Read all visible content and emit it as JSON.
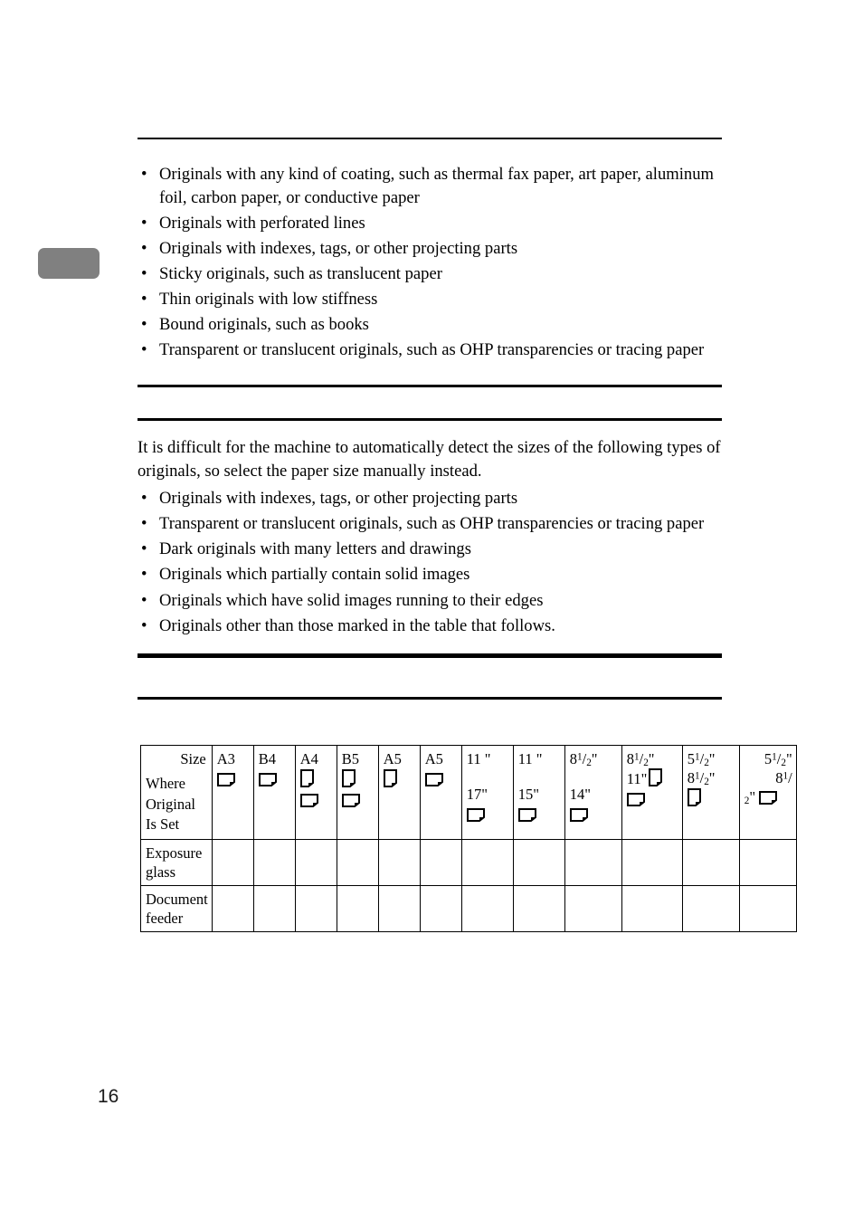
{
  "page": {
    "number": "16"
  },
  "section_one": {
    "bullets": [
      "Originals with any kind of coating, such as thermal fax paper, art paper, aluminum foil, carbon paper, or conductive paper",
      "Originals with perforated lines",
      "Originals with indexes, tags, or other projecting parts",
      "Sticky originals, such as translucent paper",
      "Thin originals with low stiffness",
      "Bound originals, such as books",
      "Transparent or translucent originals, such as OHP transparencies or tracing paper"
    ],
    "bullet_glyph": "•"
  },
  "section_two": {
    "intro": "It is difficult for the machine to automatically detect the sizes of the following types of originals, so select the paper size manually instead.",
    "bullets": [
      "Originals with indexes, tags, or other projecting parts",
      "Transparent or translucent originals, such as OHP transparencies or tracing paper",
      "Dark originals with many letters and drawings",
      "Originals which partially contain solid images",
      "Originals which have solid images running to their edges",
      "Originals other than those marked     in the table that follows."
    ]
  },
  "table": {
    "corner": {
      "size_label": "Size",
      "where_label": "Where Original Is Set"
    },
    "row_labels": [
      "Exposure glass",
      "Document feeder"
    ],
    "columns": [
      {
        "id": "a3",
        "label": "A3",
        "icons": [
          "landscape"
        ]
      },
      {
        "id": "b4",
        "label": "B4",
        "icons": [
          "landscape"
        ]
      },
      {
        "id": "a4",
        "label": "A4",
        "icons": [
          "portrait",
          "landscape"
        ]
      },
      {
        "id": "b5",
        "label": "B5",
        "icons": [
          "portrait",
          "landscape"
        ]
      },
      {
        "id": "a5-portrait",
        "label": "A5",
        "icons": [
          "portrait"
        ]
      },
      {
        "id": "a5-landscape",
        "label": "A5",
        "icons": [
          "landscape"
        ]
      },
      {
        "id": "11x17",
        "line1": "11 \"",
        "line2": "17\"",
        "icons": [
          "landscape"
        ]
      },
      {
        "id": "11x15",
        "line1": "11 \"",
        "line2": "15\"",
        "icons": [
          "landscape"
        ]
      },
      {
        "id": "85x14",
        "line1_frac": {
          "whole": "8",
          "num": "1",
          "den": "2",
          "unit": "\""
        },
        "line2": "14\"",
        "icons": [
          "landscape"
        ]
      },
      {
        "id": "85x11",
        "line1_frac": {
          "whole": "8",
          "num": "1",
          "den": "2",
          "unit": "\""
        },
        "line2": "11\"",
        "icons": [
          "portrait",
          "landscape"
        ]
      },
      {
        "id": "55x85",
        "line1_frac": {
          "whole": "5",
          "num": "1",
          "den": "2",
          "unit": "\""
        },
        "line2_frac": {
          "whole": "8",
          "num": "1",
          "den": "2",
          "unit": "\""
        },
        "icons": [
          "portrait"
        ]
      },
      {
        "id": "55x85-landscape",
        "line1_frac": {
          "whole": "5",
          "num": "1",
          "den": "2",
          "unit": "\""
        },
        "line2_frac": {
          "whole": "8",
          "num": "1",
          "den": "2",
          "unit": "\""
        },
        "icons": [
          "landscape"
        ]
      }
    ]
  },
  "colors": {
    "text": "#000000",
    "rule": "#000000",
    "margin_tab": "#808080",
    "page_number": "#1a1a1a"
  }
}
